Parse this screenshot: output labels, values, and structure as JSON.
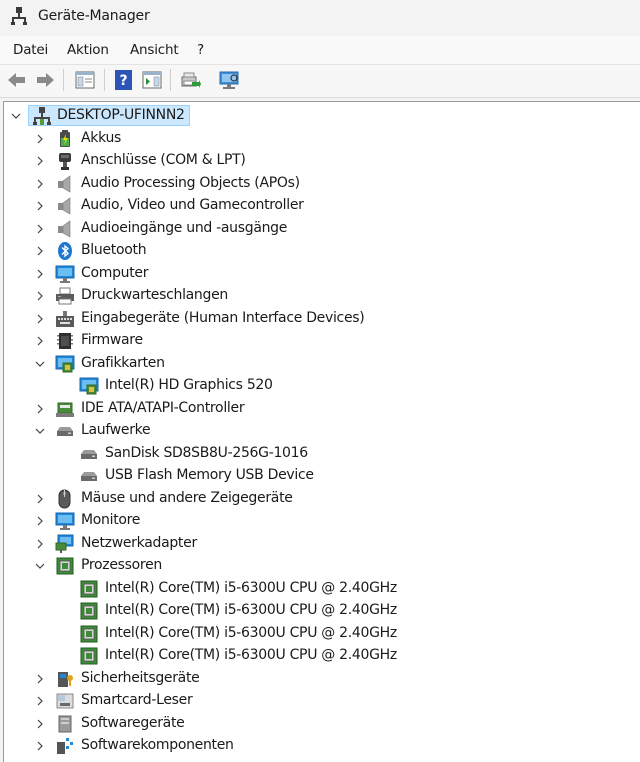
{
  "window": {
    "title": "Geräte-Manager"
  },
  "menu": [
    {
      "label": "Datei"
    },
    {
      "label": "Aktion"
    },
    {
      "label": "Ansicht"
    },
    {
      "label": "?"
    }
  ],
  "toolbar": [
    "back-icon",
    "forward-icon",
    "properties-icon",
    "help-icon",
    "show-hide-console-tree-icon",
    "update-driver-icon",
    "scan-hardware-icon"
  ],
  "colors": {
    "selection": "#cce8ff",
    "selection_border": "#99d1ff",
    "processor_green": "#3c8a3a",
    "monitor_blue": "#1f88d8"
  },
  "tree": {
    "root": {
      "label": "DESKTOP-UFINNN2",
      "expanded": true,
      "selected": true
    },
    "nodes": [
      {
        "label": "Akkus",
        "icon": "battery-icon",
        "expanded": false
      },
      {
        "label": "Anschlüsse (COM & LPT)",
        "icon": "port-icon",
        "expanded": false
      },
      {
        "label": "Audio Processing Objects (APOs)",
        "icon": "speaker-icon",
        "expanded": false
      },
      {
        "label": "Audio, Video und Gamecontroller",
        "icon": "speaker-icon",
        "expanded": false
      },
      {
        "label": "Audioeingänge und -ausgänge",
        "icon": "speaker-icon",
        "expanded": false
      },
      {
        "label": "Bluetooth",
        "icon": "bluetooth-icon",
        "expanded": false
      },
      {
        "label": "Computer",
        "icon": "monitor-icon",
        "expanded": false
      },
      {
        "label": "Druckwarteschlangen",
        "icon": "printer-icon",
        "expanded": false
      },
      {
        "label": "Eingabegeräte (Human Interface Devices)",
        "icon": "hid-icon",
        "expanded": false
      },
      {
        "label": "Firmware",
        "icon": "firmware-icon",
        "expanded": false
      },
      {
        "label": "Grafikkarten",
        "icon": "display-adapter-icon",
        "expanded": true,
        "children": [
          {
            "label": "Intel(R) HD Graphics 520",
            "icon": "display-adapter-icon"
          }
        ]
      },
      {
        "label": "IDE ATA/ATAPI-Controller",
        "icon": "ide-controller-icon",
        "expanded": false
      },
      {
        "label": "Laufwerke",
        "icon": "drive-icon",
        "expanded": true,
        "children": [
          {
            "label": "SanDisk SD8SB8U-256G-1016",
            "icon": "drive-icon"
          },
          {
            "label": "USB Flash Memory USB Device",
            "icon": "drive-icon"
          }
        ]
      },
      {
        "label": "Mäuse und andere Zeigegeräte",
        "icon": "mouse-icon",
        "expanded": false
      },
      {
        "label": "Monitore",
        "icon": "monitor-icon",
        "expanded": false
      },
      {
        "label": "Netzwerkadapter",
        "icon": "network-icon",
        "expanded": false
      },
      {
        "label": "Prozessoren",
        "icon": "processor-icon",
        "expanded": true,
        "children": [
          {
            "label": "Intel(R) Core(TM) i5-6300U CPU @ 2.40GHz",
            "icon": "processor-icon"
          },
          {
            "label": "Intel(R) Core(TM) i5-6300U CPU @ 2.40GHz",
            "icon": "processor-icon"
          },
          {
            "label": "Intel(R) Core(TM) i5-6300U CPU @ 2.40GHz",
            "icon": "processor-icon"
          },
          {
            "label": "Intel(R) Core(TM) i5-6300U CPU @ 2.40GHz",
            "icon": "processor-icon"
          }
        ]
      },
      {
        "label": "Sicherheitsgeräte",
        "icon": "security-icon",
        "expanded": false
      },
      {
        "label": "Smartcard-Leser",
        "icon": "smartcard-icon",
        "expanded": false
      },
      {
        "label": "Softwaregeräte",
        "icon": "software-device-icon",
        "expanded": false
      },
      {
        "label": "Softwarekomponenten",
        "icon": "software-component-icon",
        "expanded": false
      }
    ]
  }
}
